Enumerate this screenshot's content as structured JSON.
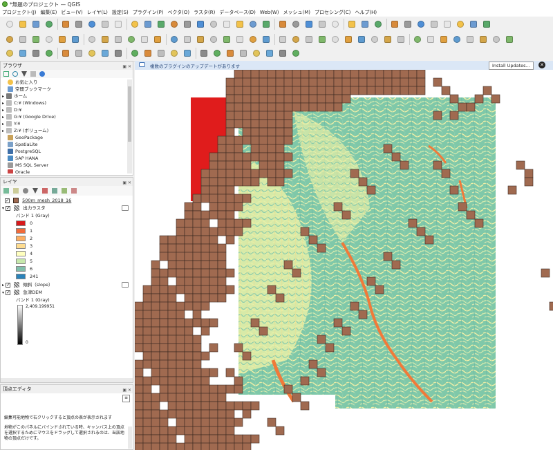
{
  "window": {
    "title": "*無題のプロジェクト — QGIS"
  },
  "menu": [
    "プロジェクト(J)",
    "編集(E)",
    "ビュー(V)",
    "レイヤ(L)",
    "設定(S)",
    "プラグイン(P)",
    "ベクタ(O)",
    "ラスタ(R)",
    "データベース(D)",
    "Web(W)",
    "メッシュ(M)",
    "プロセシング(C)",
    "ヘルプ(H)"
  ],
  "browser": {
    "title": "ブラウザ",
    "items": [
      "お気に入り",
      "空間ブックマーク",
      "ホーム",
      "C:¥ (Windows)",
      "D:¥",
      "G:¥ (Google Drive)",
      "Y:¥",
      "Z:¥ (ボリューム)",
      "GeoPackage",
      "SpatiaLite",
      "PostgreSQL",
      "SAP HANA",
      "MS SQL Server",
      "Oracle"
    ]
  },
  "layers": {
    "title": "レイヤ",
    "mesh_layer": "500m_mesh_2018_16",
    "output_raster": "出力ラスタ",
    "band_label": "バンド 1 (Gray)",
    "legend": [
      {
        "label": "0",
        "color": "#d7191c"
      },
      {
        "label": "1",
        "color": "#f06a3a"
      },
      {
        "label": "2",
        "color": "#fdae61"
      },
      {
        "label": "3",
        "color": "#fedc90"
      },
      {
        "label": "4",
        "color": "#ffffbf"
      },
      {
        "label": "5",
        "color": "#c7e9ad"
      },
      {
        "label": "6",
        "color": "#80bfab"
      },
      {
        "label": "241",
        "color": "#2b83ba"
      }
    ],
    "slope_layer": "傾斜（slope）",
    "dem_layer": "急津DEM",
    "dem_band": "バンド 1 (Gray)",
    "dem_max": "2,409.199951",
    "dem_min": "0"
  },
  "vertex_editor": {
    "title": "頂点エディタ",
    "hint1": "編集可能地物で右クリックすると頂点の表が表示されます",
    "hint2": "地物がこのパネルにバインドされている時、キャンバス上の頂点を選択するためにマウスをドラッグして選択されるのは、当該地物の頂点だけです。"
  },
  "infobar": {
    "message": "複数のプラグインのアップデートがあります",
    "button": "Install Updates…"
  },
  "colors": {
    "mesh_fill": "#a06a50",
    "mesh_stroke": "#3a2a20",
    "raster_red": "#e01c1c",
    "raster_base": "#7fc8a9"
  }
}
